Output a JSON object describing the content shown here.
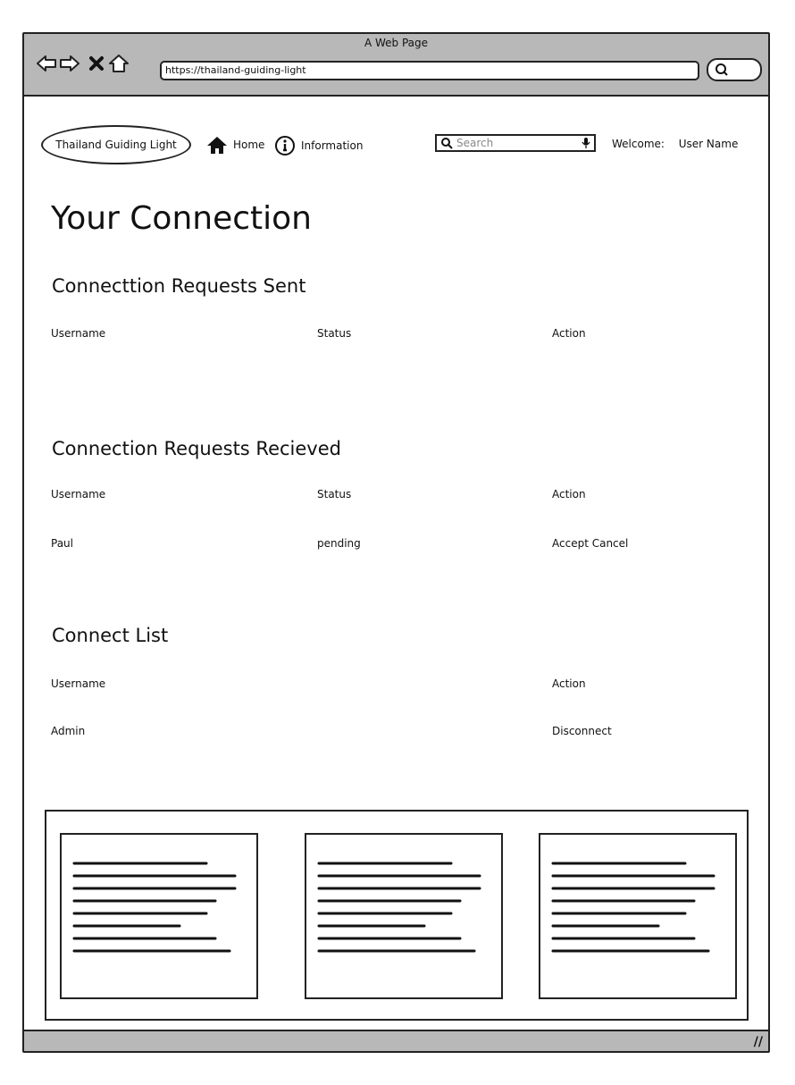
{
  "browser": {
    "title": "A Web Page",
    "url": "https://thailand-guiding-light"
  },
  "header": {
    "logo": "Thailand Guiding Light",
    "nav": [
      {
        "label": "Home",
        "icon": "home-icon"
      },
      {
        "label": "Information",
        "icon": "info-icon"
      }
    ],
    "search_placeholder": "Search",
    "welcome_label": "Welcome:",
    "user_name": "User Name"
  },
  "page": {
    "title": "Your Connection",
    "sent": {
      "heading": "Connecttion Requests Sent",
      "columns": [
        "Username",
        "Status",
        "Action"
      ],
      "rows": []
    },
    "received": {
      "heading": "Connection Requests Recieved",
      "columns": [
        "Username",
        "Status",
        "Action"
      ],
      "rows": [
        {
          "username": "Paul",
          "status": "pending",
          "action": "Accept Cancel"
        }
      ]
    },
    "connect_list": {
      "heading": "Connect List",
      "columns": [
        "Username",
        "Action"
      ],
      "rows": [
        {
          "username": "Admin",
          "action": "Disconnect"
        }
      ]
    }
  },
  "footer": {
    "cards": 3
  }
}
